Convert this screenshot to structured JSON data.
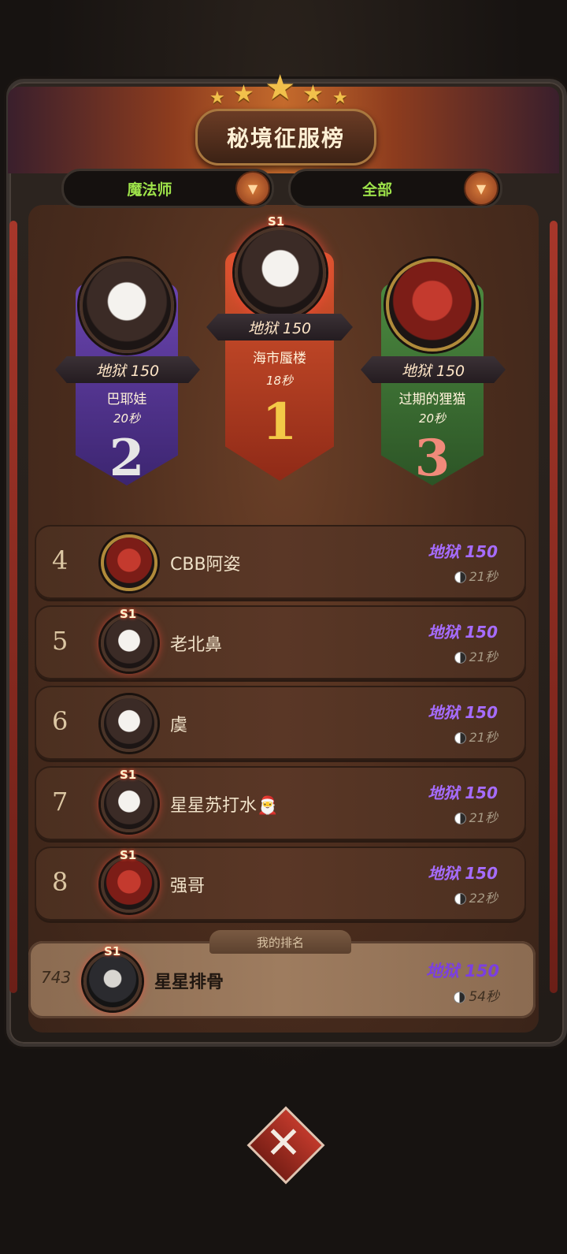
{
  "header": {
    "title": "秘境征服榜",
    "stars_count": 5
  },
  "filters": {
    "class_label": "魔法师",
    "scope_label": "全部",
    "dropdown_icon": "chevron-down-icon"
  },
  "podium": [
    {
      "rank": "2",
      "level": "地狱 150",
      "name": "巴耶娃",
      "time": "20秒",
      "color": "#5a3a9a"
    },
    {
      "rank": "1",
      "level": "地狱 150",
      "name": "海市蜃楼",
      "time": "18秒",
      "season": "S1",
      "color": "#c1432a"
    },
    {
      "rank": "3",
      "level": "地狱 150",
      "name": "过期的狸猫",
      "time": "20秒",
      "color": "#3e6e35"
    }
  ],
  "list": [
    {
      "rank": "4",
      "name": "CBB阿姿",
      "level": "地狱 150",
      "time": "21秒"
    },
    {
      "rank": "5",
      "name": "老北鼻",
      "level": "地狱 150",
      "time": "21秒",
      "season": "S1"
    },
    {
      "rank": "6",
      "name": "虞",
      "level": "地狱 150",
      "time": "21秒"
    },
    {
      "rank": "7",
      "name": "星星苏打水🎅",
      "level": "地狱 150",
      "time": "21秒",
      "season": "S1"
    },
    {
      "rank": "8",
      "name": "强哥",
      "level": "地狱 150",
      "time": "22秒",
      "season": "S1"
    }
  ],
  "my_rank": {
    "tab_label": "我的排名",
    "rank": "743",
    "name": "星星排骨",
    "level": "地狱 150",
    "time": "54秒",
    "season": "S1"
  },
  "bottom": {
    "close_icon": "close-icon"
  }
}
